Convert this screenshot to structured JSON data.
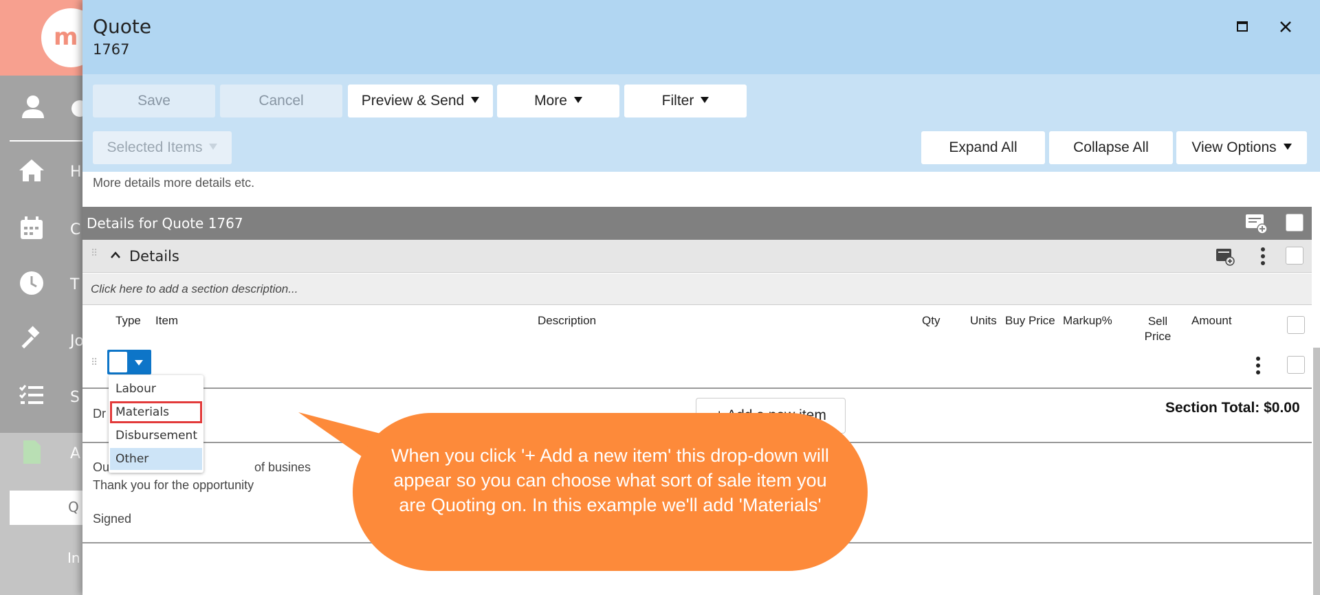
{
  "app": {
    "logo_text": "m",
    "nav_items": [
      "H",
      "C",
      "T",
      "Jo",
      "S",
      "A"
    ],
    "active_item": "Q",
    "sub_item": "In"
  },
  "modal": {
    "title": "Quote",
    "number": "1767",
    "header_bg": "#b1d6f2",
    "toolbar_bg": "#c7e1f5"
  },
  "toolbar": {
    "save_label": "Save",
    "cancel_label": "Cancel",
    "preview_send_label": "Preview & Send",
    "more_label": "More",
    "filter_label": "Filter",
    "selected_items_label": "Selected Items",
    "expand_all_label": "Expand All",
    "collapse_all_label": "Collapse All",
    "view_options_label": "View Options"
  },
  "content": {
    "more_details_text": "More details more details etc.",
    "details_bar_title": "Details for Quote 1767",
    "section_title": "Details",
    "section_description_placeholder": "Click here to add a section description...",
    "columns": [
      "Type",
      "Item",
      "Description",
      "Qty",
      "Units",
      "Buy Price",
      "Markup%",
      "Sell Price",
      "Amount"
    ],
    "draft_text_partial": "Dr",
    "add_item_label": "+ Add a new item",
    "section_total": "Section Total: $0.00",
    "footer_line1_left": "Ou",
    "footer_line1_right": "of busines",
    "footer_line2": "Thank you for the opportunity",
    "signed": "Signed"
  },
  "type_dropdown": {
    "options": [
      "Labour",
      "Materials",
      "Disbursement",
      "Other"
    ],
    "highlighted": "Materials",
    "selected": "Other",
    "accent": "#0d75c8"
  },
  "callout": {
    "text": "When you click '+ Add a new item' this drop-down will appear so you can choose what sort of sale item you are Quoting on. In this example we'll add 'Materials'",
    "color": "#fd8a3a"
  }
}
